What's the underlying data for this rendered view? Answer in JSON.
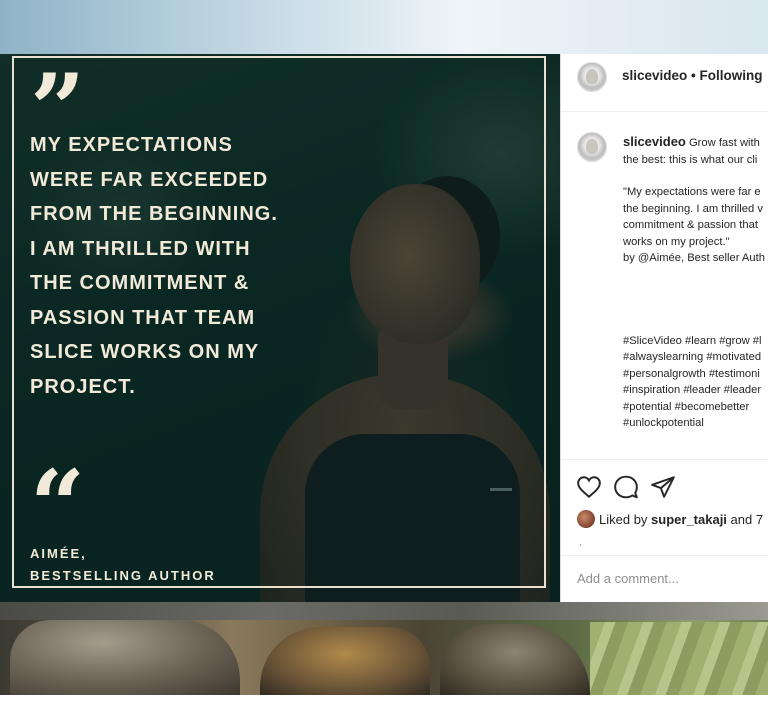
{
  "post": {
    "quote_lines": [
      "MY EXPECTATIONS",
      "WERE FAR EXCEEDED",
      "FROM THE BEGINNING.",
      "I AM THRILLED WITH",
      "THE COMMITMENT &",
      "PASSION THAT TEAM",
      "SLICE WORKS ON MY",
      "PROJECT."
    ],
    "open_quote": "“",
    "close_quote": "”",
    "author_name": "AIMÉE,",
    "author_title": "BESTSELLING AUTHOR"
  },
  "instagram": {
    "username": "slicevideo",
    "follow_status": "• Following",
    "caption": {
      "username": "slicevideo",
      "first_line_rest": " Grow fast with",
      "line2": "the best: this is what our cli",
      "quote_lines": [
        "\"My expectations were far e",
        "the beginning. I am thrilled v",
        "commitment & passion that",
        "works on my project.\"",
        "by @Aimée, Best seller Auth"
      ],
      "hashtag_lines": [
        "#SliceVideo #learn #grow #l",
        "#alwayslearning  #motivated",
        "#personalgrowth #testimoni",
        "#inspiration #leader #leader",
        "#potential  #becomebetter",
        "#unlockpotential"
      ]
    },
    "likes": {
      "prefix": "Liked by ",
      "user": "super_takaji",
      "suffix": " and 7"
    },
    "small_mark": ",",
    "comment_placeholder": "Add a comment..."
  },
  "icons": {
    "like": "heart-icon",
    "comment": "comment-icon",
    "share": "paper-plane-icon"
  }
}
